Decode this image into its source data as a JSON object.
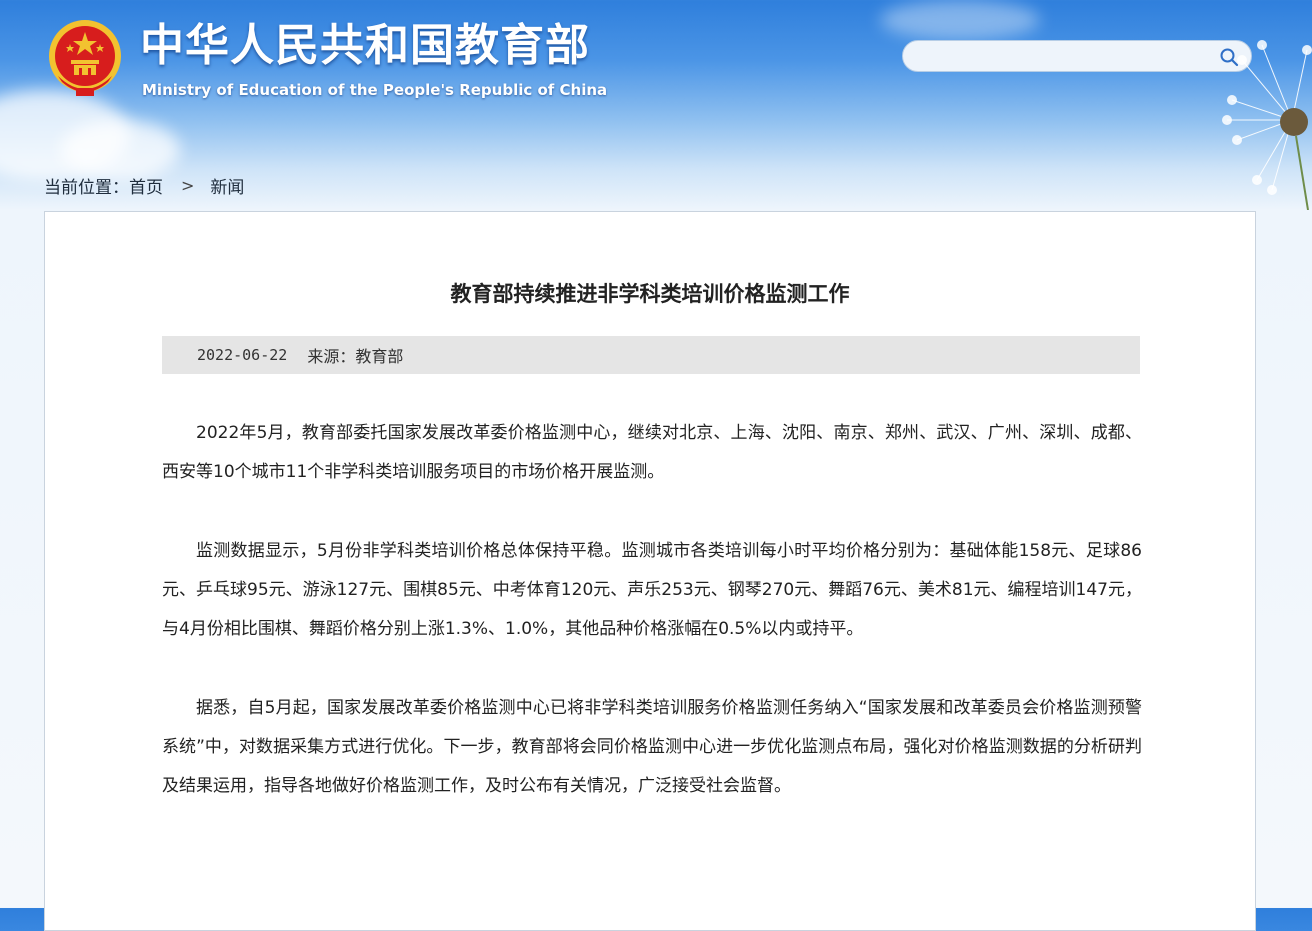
{
  "header": {
    "title_cn": "中华人民共和国教育部",
    "title_en": "Ministry of Education of the People's Republic of China",
    "emblem_icon": "national-emblem-icon",
    "search": {
      "placeholder": "",
      "value": "",
      "icon": "search-icon"
    }
  },
  "breadcrumb": {
    "label": "当前位置：",
    "home": "首页",
    "separator": ">",
    "current": "新闻"
  },
  "article": {
    "title": "教育部持续推进非学科类培训价格监测工作",
    "date": "2022-06-22",
    "source_label": "来源：",
    "source": "教育部",
    "paragraphs": [
      "2022年5月，教育部委托国家发展改革委价格监测中心，继续对北京、上海、沈阳、南京、郑州、武汉、广州、深圳、成都、西安等10个城市11个非学科类培训服务项目的市场价格开展监测。",
      "监测数据显示，5月份非学科类培训价格总体保持平稳。监测城市各类培训每小时平均价格分别为：基础体能158元、足球86元、乒乓球95元、游泳127元、围棋85元、中考体育120元、声乐253元、钢琴270元、舞蹈76元、美术81元、编程培训147元，与4月份相比围棋、舞蹈价格分别上涨1.3%、1.0%，其他品种价格涨幅在0.5%以内或持平。",
      "据悉，自5月起，国家发展改革委价格监测中心已将非学科类培训服务价格监测任务纳入“国家发展和改革委员会价格监测预警系统”中，对数据采集方式进行优化。下一步，教育部将会同价格监测中心进一步优化监测点布局，强化对价格监测数据的分析研判及结果运用，指导各地做好价格监测工作，及时公布有关情况，广泛接受社会监督。"
    ]
  },
  "colors": {
    "header_blue": "#2f7fdc",
    "emblem_red": "#d71d1d",
    "emblem_gold": "#f2c230",
    "meta_bar": "#e5e5e5"
  }
}
